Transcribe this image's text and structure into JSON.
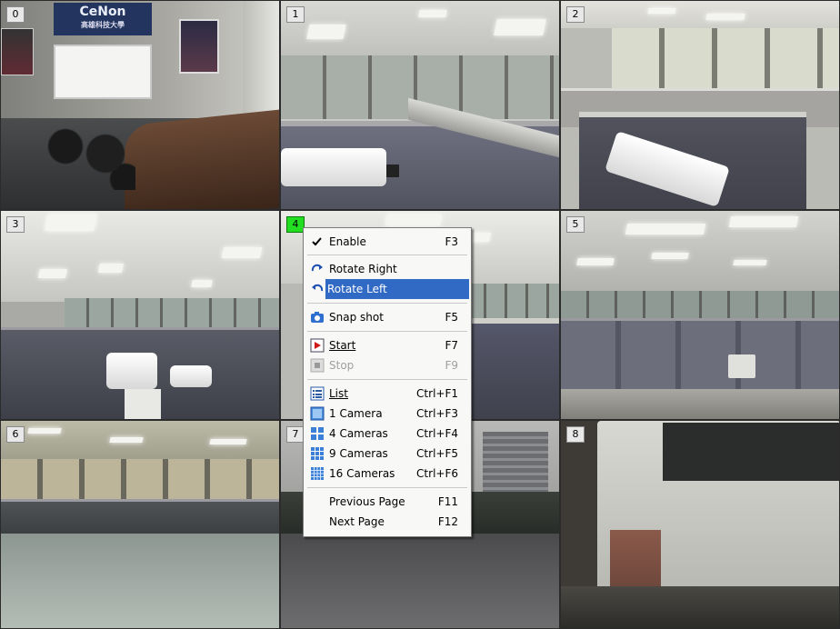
{
  "cameras": [
    {
      "label": "0"
    },
    {
      "label": "1"
    },
    {
      "label": "2"
    },
    {
      "label": "3"
    },
    {
      "label": "4"
    },
    {
      "label": "5"
    },
    {
      "label": "6"
    },
    {
      "label": "7"
    },
    {
      "label": "8"
    }
  ],
  "scene_text": {
    "conference_sign": "CeNon",
    "conference_sign_sub": "高雄科技大學"
  },
  "menu": {
    "items": [
      {
        "label": "Enable",
        "shortcut": "F3",
        "icon": "check-icon"
      },
      {
        "label": "Rotate Right",
        "shortcut": "",
        "icon": "rotate-right-icon"
      },
      {
        "label": "Rotate Left",
        "shortcut": "",
        "icon": "rotate-left-icon",
        "highlighted": true
      },
      {
        "label": "Snap shot",
        "shortcut": "F5",
        "icon": "camera-icon"
      },
      {
        "label": "Start",
        "shortcut": "F7",
        "icon": "play-icon"
      },
      {
        "label": "Stop",
        "shortcut": "F9",
        "icon": "stop-icon",
        "disabled": true
      },
      {
        "label": "List",
        "shortcut": "Ctrl+F1",
        "icon": "list-icon"
      },
      {
        "label": "1 Camera",
        "shortcut": "Ctrl+F3",
        "icon": "one-camera-icon"
      },
      {
        "label": "4 Cameras",
        "shortcut": "Ctrl+F4",
        "icon": "four-cameras-icon"
      },
      {
        "label": "9 Cameras",
        "shortcut": "Ctrl+F5",
        "icon": "nine-cameras-icon"
      },
      {
        "label": "16 Cameras",
        "shortcut": "Ctrl+F6",
        "icon": "sixteen-cameras-icon"
      },
      {
        "label": "Previous Page",
        "shortcut": "F11",
        "icon": ""
      },
      {
        "label": "Next Page",
        "shortcut": "F12",
        "icon": ""
      }
    ]
  },
  "colors": {
    "highlight": "#316ac5",
    "active_camera_label": "#22dd22"
  }
}
